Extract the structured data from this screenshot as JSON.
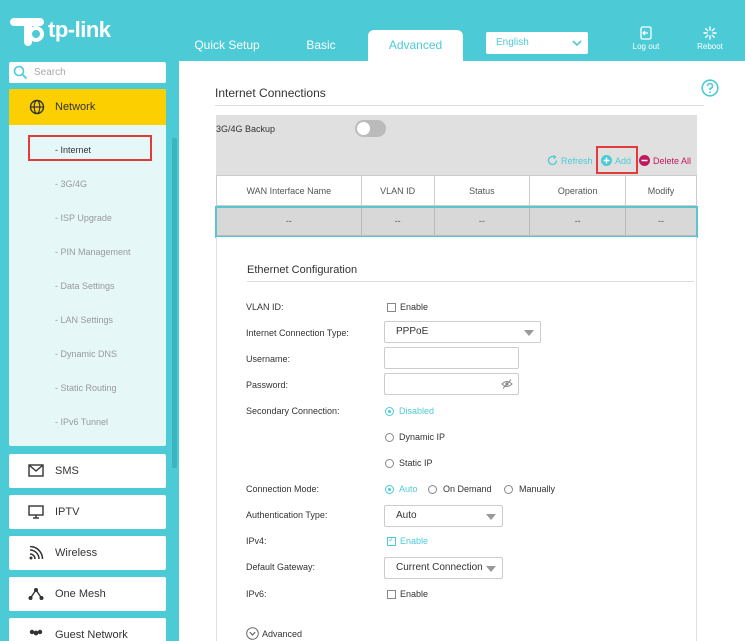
{
  "header": {
    "brand": "tp-link",
    "tabs": [
      {
        "label": "Quick Setup"
      },
      {
        "label": "Basic"
      },
      {
        "label": "Advanced"
      }
    ],
    "language": "English",
    "logout_label": "Log out",
    "reboot_label": "Reboot"
  },
  "sidebar": {
    "search_placeholder": "Search",
    "network_label": "Network",
    "network_items": [
      {
        "label": "- Internet"
      },
      {
        "label": "- 3G/4G"
      },
      {
        "label": "- ISP Upgrade"
      },
      {
        "label": "- PIN Management"
      },
      {
        "label": "- Data Settings"
      },
      {
        "label": "- LAN Settings"
      },
      {
        "label": "- Dynamic DNS"
      },
      {
        "label": "- Static Routing"
      },
      {
        "label": "- IPv6 Tunnel"
      }
    ],
    "menu": [
      {
        "label": "SMS"
      },
      {
        "label": "IPTV"
      },
      {
        "label": "Wireless"
      },
      {
        "label": "One Mesh"
      },
      {
        "label": "Guest Network"
      }
    ]
  },
  "main": {
    "title": "Internet Connections",
    "backup_label": "3G/4G Backup",
    "actions": {
      "refresh": "Refresh",
      "add": "Add",
      "delete_all": "Delete All"
    },
    "table": {
      "columns": [
        "WAN Interface Name",
        "VLAN ID",
        "Status",
        "Operation",
        "Modify"
      ],
      "row": [
        "--",
        "--",
        "--",
        "--",
        "--"
      ]
    },
    "ethernet": {
      "title": "Ethernet Configuration",
      "vlan_label": "VLAN ID:",
      "vlan_enable": "Enable",
      "conn_type_label": "Internet Connection Type:",
      "conn_type_value": "PPPoE",
      "username_label": "Username:",
      "password_label": "Password:",
      "secondary_label": "Secondary Connection:",
      "secondary_options": [
        "Disabled",
        "Dynamic IP",
        "Static IP"
      ],
      "mode_label": "Connection Mode:",
      "mode_options": [
        "Auto",
        "On Demand",
        "Manually"
      ],
      "auth_label": "Authentication Type:",
      "auth_value": "Auto",
      "ipv4_label": "IPv4:",
      "ipv4_enable": "Enable",
      "gateway_label": "Default Gateway:",
      "gateway_value": "Current Connection",
      "ipv6_label": "IPv6:",
      "ipv6_enable": "Enable",
      "advanced_label": "Advanced"
    }
  }
}
